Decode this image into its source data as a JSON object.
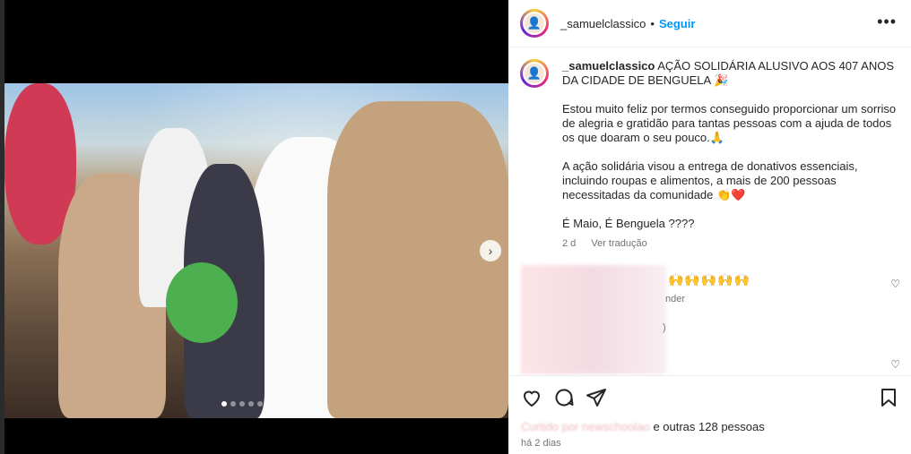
{
  "post": {
    "username": "_samuelclassico",
    "separator": "•",
    "follow_label": "Seguir",
    "more_label": "•••"
  },
  "media": {
    "next_arrow": "›",
    "slide_count": 10,
    "active_slide": 1
  },
  "caption": {
    "username": "_samuelclassico",
    "paragraphs": [
      "AÇÃO SOLIDÁRIA ALUSIVO AOS 407 ANOS DA CIDADE DE BENGUELA 🎉",
      "Estou muito feliz por termos conseguido proporcionar um sorriso de alegria e gratidão para tantas pessoas com a ajuda de todos os que doaram o seu pouco.🙏",
      "A ação solidária visou a entrega de donativos essenciais, incluindo roupas e alimentos, a mais de 200 pessoas necessitadas da comunidade 👏❤️",
      "É Maio, É Benguela ????"
    ],
    "time_ago": "2 d",
    "translate_label": "Ver tradução"
  },
  "comments": {
    "emoji_row": "🙌🙌🙌🙌🙌",
    "partial_text_1": "nder",
    "partial_text_2": ")"
  },
  "actions": {
    "icons": [
      "heart-icon",
      "comment-icon",
      "share-icon",
      "bookmark-icon"
    ]
  },
  "likes": {
    "liked_by": "Curtido por newschoolao",
    "and_others": "e outras 128 pessoas"
  },
  "timestamp": "há 2 dias",
  "colors": {
    "follow": "#0095f6",
    "text": "#262626",
    "muted": "#737373"
  }
}
